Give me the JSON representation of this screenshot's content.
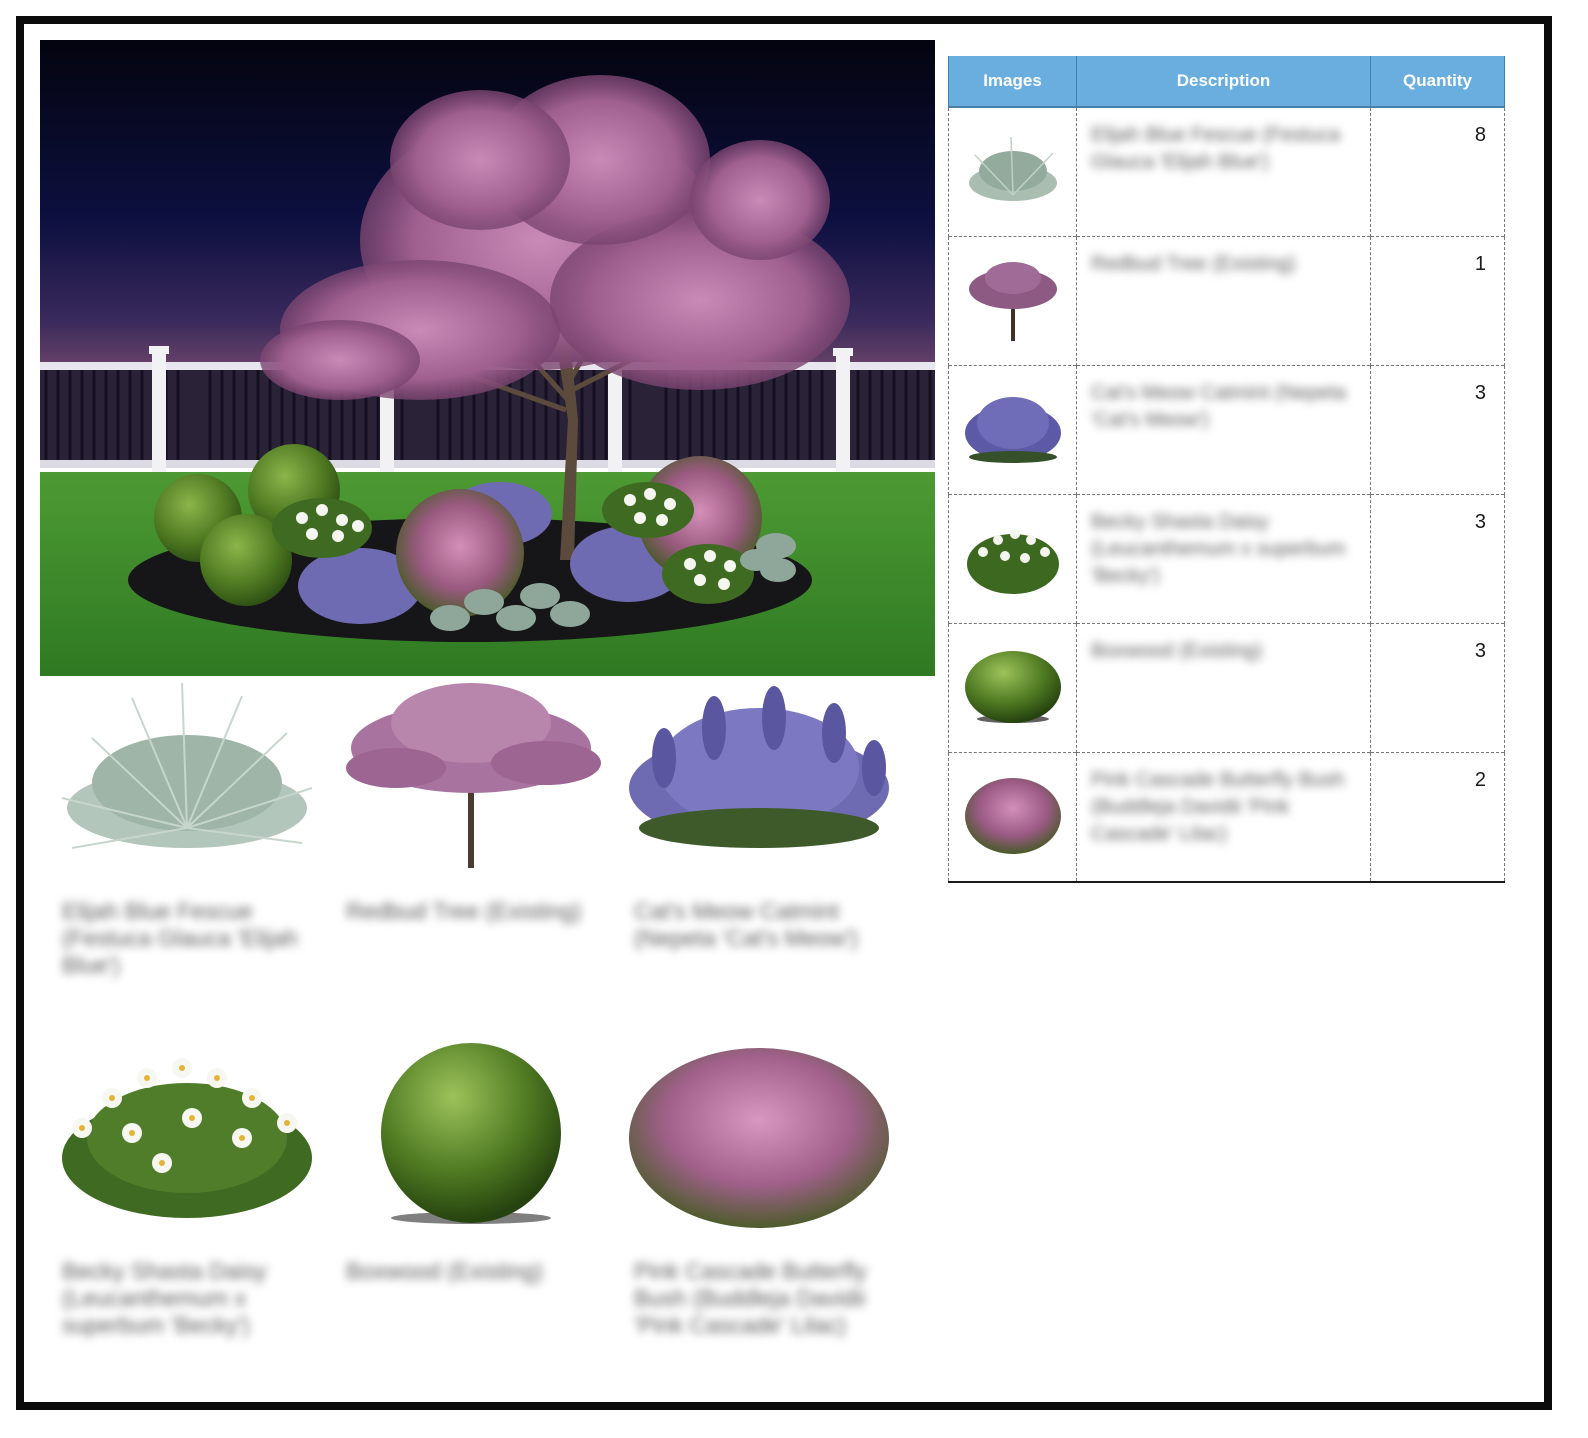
{
  "table": {
    "headers": [
      "Images",
      "Description",
      "Quantity"
    ],
    "rows": [
      {
        "image_icon": "blue-grass-icon",
        "description": "Elijah Blue Fescue (Festuca Glauca 'Elijah Blue')",
        "quantity": "8"
      },
      {
        "image_icon": "redbud-tree-icon",
        "description": "Redbud Tree (Existing)",
        "quantity": "1"
      },
      {
        "image_icon": "catmint-icon",
        "description": "Cat's Meow Catmint (Nepeta 'Cat's Meow')",
        "quantity": "3"
      },
      {
        "image_icon": "shasta-daisy-icon",
        "description": "Becky Shasta Daisy (Leucanthemum x superbum 'Becky')",
        "quantity": "3"
      },
      {
        "image_icon": "boxwood-icon",
        "description": "Boxwood (Existing)",
        "quantity": "3"
      },
      {
        "image_icon": "butterfly-bush-icon",
        "description": "Pink Cascade Butterfly Bush (Buddleja Davidii 'Pink Cascade' Lilac)",
        "quantity": "2"
      }
    ]
  },
  "gallery": [
    {
      "image_icon": "blue-grass-icon",
      "label": "Elijah Blue Fescue (Festuca Glauca 'Elijah Blue')"
    },
    {
      "image_icon": "redbud-tree-icon",
      "label": "Redbud Tree (Existing)"
    },
    {
      "image_icon": "catmint-icon",
      "label": "Cat's Meow Catmint (Nepeta 'Cat's Meow')"
    },
    {
      "image_icon": "shasta-daisy-icon",
      "label": "Becky Shasta Daisy (Leucanthemum x superbum 'Becky')"
    },
    {
      "image_icon": "boxwood-icon",
      "label": "Boxwood (Existing)"
    },
    {
      "image_icon": "butterfly-bush-icon",
      "label": "Pink Cascade Butterfly Bush (Buddleja Davidii 'Pink Cascade' Lilac)"
    }
  ],
  "colors": {
    "table_header": "#6aaee0",
    "sky_top": "#05061a",
    "sky_bottom": "#5a3c6a",
    "lawn": "#3c8a2a",
    "mulch": "#1a1a1c",
    "redbud_blossom": "#b0709f",
    "catmint": "#6e6bb3",
    "boxwood": "#4f7a22"
  }
}
